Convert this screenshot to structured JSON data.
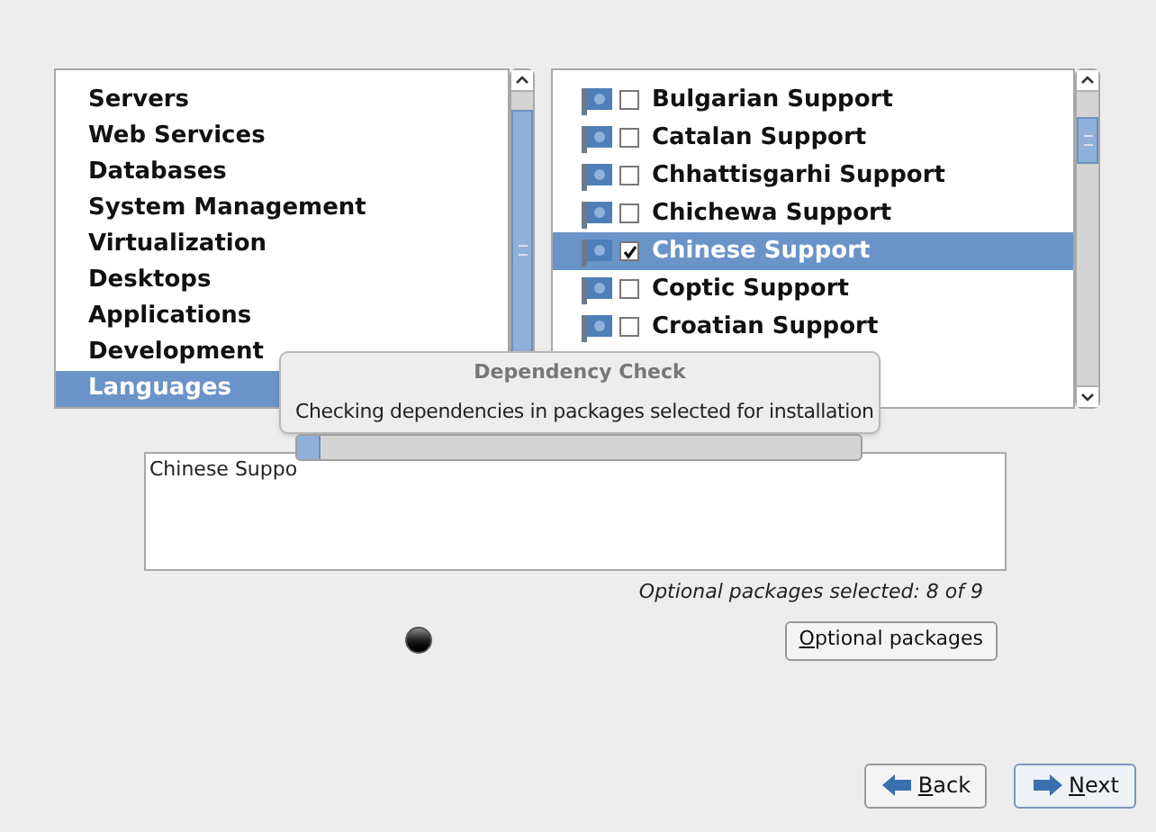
{
  "groups": [
    {
      "label": "Servers",
      "selected": false
    },
    {
      "label": "Web Services",
      "selected": false
    },
    {
      "label": "Databases",
      "selected": false
    },
    {
      "label": "System Management",
      "selected": false
    },
    {
      "label": "Virtualization",
      "selected": false
    },
    {
      "label": "Desktops",
      "selected": false
    },
    {
      "label": "Applications",
      "selected": false
    },
    {
      "label": "Development",
      "selected": false
    },
    {
      "label": "Languages",
      "selected": true
    }
  ],
  "packages": [
    {
      "label": "Bulgarian Support",
      "checked": false,
      "selected": false
    },
    {
      "label": "Catalan Support",
      "checked": false,
      "selected": false
    },
    {
      "label": "Chhattisgarhi Support",
      "checked": false,
      "selected": false
    },
    {
      "label": "Chichewa Support",
      "checked": false,
      "selected": false
    },
    {
      "label": "Chinese Support",
      "checked": true,
      "selected": true
    },
    {
      "label": "Coptic Support",
      "checked": false,
      "selected": false
    },
    {
      "label": "Croatian Support",
      "checked": false,
      "selected": false
    }
  ],
  "description": "Chinese Suppo",
  "optional_status": "Optional packages selected: 8 of 9",
  "optional_button": "Optional packages",
  "buttons": [
    {
      "label": "Back",
      "kind": "back"
    },
    {
      "label": "Next",
      "kind": "next"
    }
  ],
  "dialog": {
    "title": "Dependency Check",
    "message": "Checking dependencies in packages selected for installation",
    "level": 0.04
  }
}
